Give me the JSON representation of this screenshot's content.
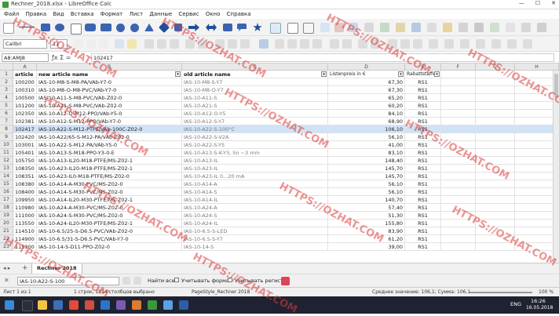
{
  "window": {
    "title": "Rechner_2018.xlsx - LibreOffice Calc"
  },
  "menu": [
    "Файл",
    "Правка",
    "Вид",
    "Вставка",
    "Формат",
    "Лист",
    "Данные",
    "Сервис",
    "Окно",
    "Справка"
  ],
  "toolbar": {
    "font_name": "Calibri",
    "font_size": "11"
  },
  "formula_bar": {
    "name_box": "A8:AMJ8",
    "formula": "102417"
  },
  "columns": [
    "A",
    "B",
    "C",
    "D",
    "E",
    "F",
    "G",
    "H"
  ],
  "header_row": {
    "row_num": "1",
    "article": "article",
    "new_name": "new article name",
    "old_name": "old article name",
    "price": "Listenpreis in €",
    "rabatt": "Rabattstaffe"
  },
  "rows": [
    {
      "row": "2",
      "article": "100200",
      "new_name": "IAS-10-M8-S-M8-PA/VAb-Y7-0",
      "old_name": "IAS-10-M8-S-Y7",
      "price": "67,30",
      "rabatt": "RS1"
    },
    {
      "row": "3",
      "article": "100310",
      "new_name": "IAS-10-M8-O-M8-PVC/VAb-Y7-0",
      "old_name": "IAS-10-M8-O-Y7",
      "price": "67,30",
      "rabatt": "RS1"
    },
    {
      "row": "4",
      "article": "100500",
      "new_name": "IAS-10-A11-S-M8-PVC/VAb-Z02-0",
      "old_name": "IAS-10-A11-S",
      "price": "65,20",
      "rabatt": "RS1"
    },
    {
      "row": "5",
      "article": "101200",
      "new_name": "IAS-10-A21-S-M8-PVC/VAb-Z02-0",
      "old_name": "IAS-10-A21-S",
      "price": "60,20",
      "rabatt": "RS1"
    },
    {
      "row": "6",
      "article": "102350",
      "new_name": "IAS-10-A12-O-M12-PPO/VAb-Y5-0",
      "old_name": "IAS-10-A12-O-Y5",
      "price": "84,10",
      "rabatt": "RS1"
    },
    {
      "row": "7",
      "article": "102381",
      "new_name": "IAS-10-A12-S-M12-PPO/VAb-Y7-0",
      "old_name": "IAS-10-A12-S-Y7",
      "price": "68,90",
      "rabatt": "RS1"
    },
    {
      "row": "8",
      "article": "102417",
      "new_name": "IAS-10-A22-S-M12-PTFE/VAb-100C-Z02-0",
      "old_name": "IAS-10-A22-S-100°C",
      "price": "106,10",
      "rabatt": "RS1",
      "selected": true
    },
    {
      "row": "9",
      "article": "102420",
      "new_name": "IAS-10-A22/65-S-M12-PA/VAb-Z02-0",
      "old_name": "IAS-10-A22-S-V2A",
      "price": "56,10",
      "rabatt": "RS1"
    },
    {
      "row": "10",
      "article": "103001",
      "new_name": "IAS-10-A22-S-M12-PA/VAb-Y5-0",
      "old_name": "IAS-10-A22-S-Y5",
      "price": "41,00",
      "rabatt": "RS1"
    },
    {
      "row": "11",
      "article": "105401",
      "new_name": "IAS-10-A13-S-M18-PPO-Y3-0-E",
      "old_name": "IAS-10-A13-S-K-Y3, Sn ~3 mm",
      "price": "83,10",
      "rabatt": "RS1"
    },
    {
      "row": "12",
      "article": "105750",
      "new_name": "IAS-10-A13-IL20-M18-PTFE/MS-Z02-1",
      "old_name": "IAS-10-A13-IL",
      "price": "148,40",
      "rabatt": "RS1"
    },
    {
      "row": "13",
      "article": "108350",
      "new_name": "IAS-10-A23-IL20-M18-PTFE/MS-Z02-1",
      "old_name": "IAS-10-A23-IL",
      "price": "145,70",
      "rabatt": "RS1"
    },
    {
      "row": "14",
      "article": "108351",
      "new_name": "IAS-10-A23-IL0-M18-PTFE/MS-Z02-0",
      "old_name": "IAS-10-A23-IL 0...20 mA",
      "price": "145,70",
      "rabatt": "RS1"
    },
    {
      "row": "15",
      "article": "108380",
      "new_name": "IAS-10-A14-A-M30-PVC/MS-Z02-0",
      "old_name": "IAS-10-A14-A",
      "price": "56,10",
      "rabatt": "RS1"
    },
    {
      "row": "16",
      "article": "108400",
      "new_name": "IAS-10-A14-S-M30-PVC/MS-Z02-0",
      "old_name": "IAS-10-A14-S",
      "price": "56,10",
      "rabatt": "RS1"
    },
    {
      "row": "17",
      "article": "109950",
      "new_name": "IAS-10-A14-IL20-M30-PTFE/MS-Z02-1",
      "old_name": "IAS-10-A14-IL",
      "price": "140,70",
      "rabatt": "RS1"
    },
    {
      "row": "18",
      "article": "110980",
      "new_name": "IAS-10-A24-A-M30-PVC/MS-Z02-0",
      "old_name": "IAS-10-A24-A",
      "price": "57,40",
      "rabatt": "RS1"
    },
    {
      "row": "19",
      "article": "111000",
      "new_name": "IAS-10-A24-S-M30-PVC/MS-Z02-0",
      "old_name": "IAS-10-A24-S",
      "price": "51,30",
      "rabatt": "RS1"
    },
    {
      "row": "20",
      "article": "113550",
      "new_name": "IAS-10-A24-IL20-M30-PTFE/MS-Z02-1",
      "old_name": "IAS-10-A24-IL",
      "price": "155,80",
      "rabatt": "RS1"
    },
    {
      "row": "21",
      "article": "114510",
      "new_name": "IAS-10-6.5/25-S-D6.5-PVC/VAb-Z02-0",
      "old_name": "IAS-10-6.5-S-LED",
      "price": "83,90",
      "rabatt": "RS1"
    },
    {
      "row": "22",
      "article": "114900",
      "new_name": "IAS-10-6.5/31-S-D6.5-PVC/VAb-Y7-0",
      "old_name": "IAS-10-6.5-S-Y7",
      "price": "61,20",
      "rabatt": "RS1"
    },
    {
      "row": "23",
      "article": "115300",
      "new_name": "IAS-10-14-S-D11-PPO-Z02-0",
      "old_name": "IAS-10-14-S",
      "price": "39,00",
      "rabatt": "RS1"
    }
  ],
  "sheet_tab": "Rechner 2018",
  "find_bar": {
    "value": "IAS-10-A22-S-100",
    "find_all": "Найти все",
    "match_format": "Учитывать формат",
    "match_case": "Учитывать регистр"
  },
  "status": {
    "sheet": "Лист 1 из 1",
    "selection": "1 строк, 1024 столбцов выбрано",
    "page_style": "PageStyle_Rechner 2018",
    "sum": "Среднее значение: 106,1; Сумма: 106,1",
    "zoom": "100 %"
  },
  "taskbar": {
    "lang": "ENG",
    "time": "16:26",
    "date": "16.05.2018"
  },
  "watermark": "HTTPS://OZHAT.COM",
  "colors": {
    "selection": "#cfe3f7",
    "taskbar": "#1f2230",
    "watermark": "rgba(220,60,60,0.55)"
  }
}
